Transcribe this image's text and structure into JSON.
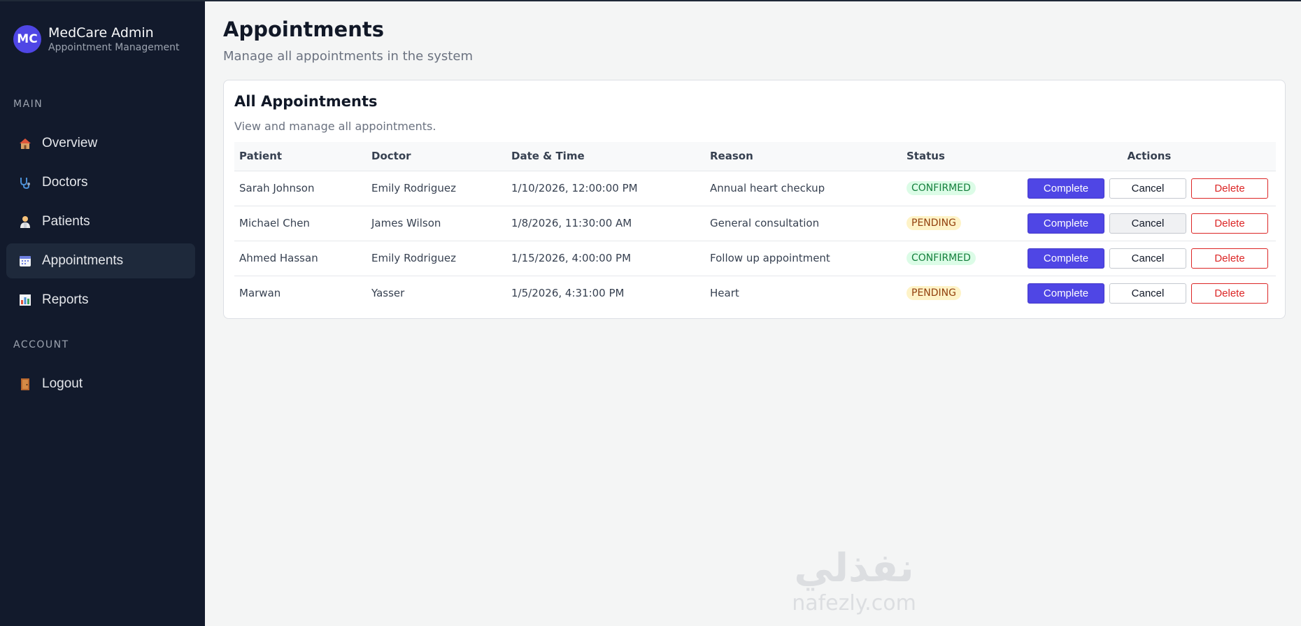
{
  "sidebar": {
    "avatar_initials": "MC",
    "brand_title": "MedCare Admin",
    "brand_subtitle": "Appointment Management",
    "sections": {
      "main_label": "MAIN",
      "account_label": "ACCOUNT"
    },
    "items": [
      {
        "label": "Overview",
        "icon": "house-icon"
      },
      {
        "label": "Doctors",
        "icon": "stethoscope-icon"
      },
      {
        "label": "Patients",
        "icon": "person-icon"
      },
      {
        "label": "Appointments",
        "icon": "calendar-icon"
      },
      {
        "label": "Reports",
        "icon": "bar-chart-icon"
      }
    ],
    "logout": {
      "label": "Logout",
      "icon": "door-icon"
    }
  },
  "header": {
    "title": "Appointments",
    "subtitle": "Manage all appointments in the system"
  },
  "card": {
    "title": "All Appointments",
    "subtitle": "View and manage all appointments."
  },
  "table": {
    "columns": [
      "Patient",
      "Doctor",
      "Date & Time",
      "Reason",
      "Status",
      "Actions"
    ],
    "rows": [
      {
        "patient": "Sarah Johnson",
        "doctor": "Emily Rodriguez",
        "datetime": "1/10/2026, 12:00:00 PM",
        "reason": "Annual heart checkup",
        "status": "CONFIRMED"
      },
      {
        "patient": "Michael Chen",
        "doctor": "James Wilson",
        "datetime": "1/8/2026, 11:30:00 AM",
        "reason": "General consultation",
        "status": "PENDING"
      },
      {
        "patient": "Ahmed Hassan",
        "doctor": "Emily Rodriguez",
        "datetime": "1/15/2026, 4:00:00 PM",
        "reason": "Follow up appointment",
        "status": "CONFIRMED"
      },
      {
        "patient": "Marwan",
        "doctor": "Yasser",
        "datetime": "1/5/2026, 4:31:00 PM",
        "reason": "Heart",
        "status": "PENDING"
      }
    ],
    "actions": {
      "complete": "Complete",
      "cancel": "Cancel",
      "delete": "Delete"
    }
  },
  "colors": {
    "sidebar_bg": "#121a2c",
    "accent": "#4f46e5",
    "danger": "#dc2626",
    "confirmed": "#15803d",
    "pending": "#92400e"
  },
  "watermark": {
    "arabic": "نفذلي",
    "latin": "nafezly.com"
  }
}
